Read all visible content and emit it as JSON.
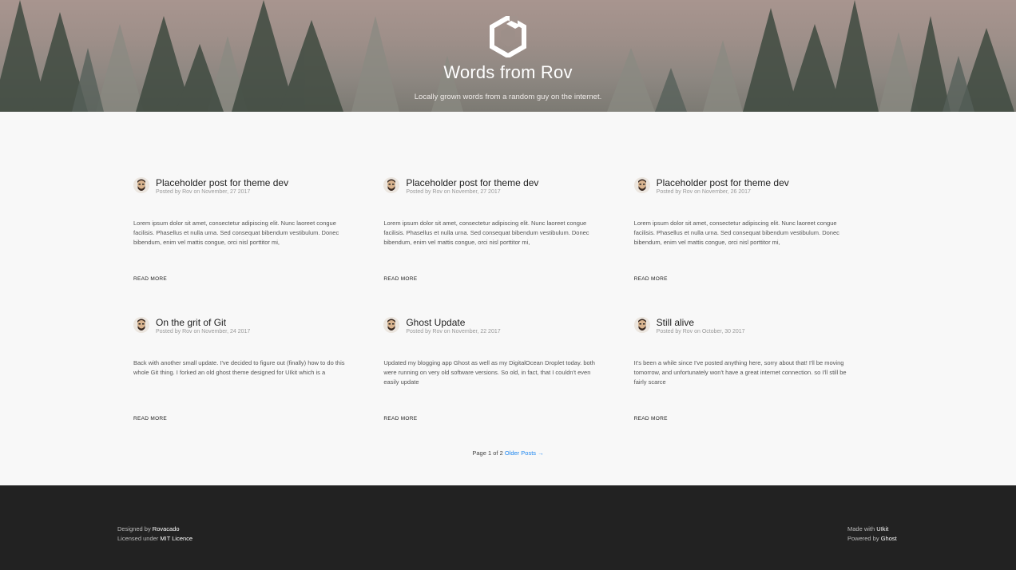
{
  "header": {
    "site_title": "Words from Rov",
    "site_description": "Locally grown words from a random guy on the internet.",
    "logo_icon": "uikit-logo-icon"
  },
  "posts": [
    {
      "title": "Placeholder post for theme dev",
      "meta": "Posted by Rov on November, 27 2017",
      "excerpt": "Lorem ipsum dolor sit amet, consectetur adipiscing elit. Nunc laoreet congue facilisis. Phasellus et nulla urna. Sed consequat bibendum vestibulum. Donec bibendum, enim vel mattis congue, orci nisl porttitor mi,",
      "read_more": "READ MORE"
    },
    {
      "title": "Placeholder post for theme dev",
      "meta": "Posted by Rov on November, 27 2017",
      "excerpt": "Lorem ipsum dolor sit amet, consectetur adipiscing elit. Nunc laoreet congue facilisis. Phasellus et nulla urna. Sed consequat bibendum vestibulum. Donec bibendum, enim vel mattis congue, orci nisl porttitor mi,",
      "read_more": "READ MORE"
    },
    {
      "title": "Placeholder post for theme dev",
      "meta": "Posted by Rov on November, 26 2017",
      "excerpt": "Lorem ipsum dolor sit amet, consectetur adipiscing elit. Nunc laoreet congue facilisis. Phasellus et nulla urna. Sed consequat bibendum vestibulum. Donec bibendum, enim vel mattis congue, orci nisl porttitor mi,",
      "read_more": "READ MORE"
    },
    {
      "title": "On the grit of Git",
      "meta": "Posted by Rov on November, 24 2017",
      "excerpt": "Back with another small update. I've decided to figure out (finally) how to do this whole Git thing. I forked an old ghost theme designed for UIkit which is a",
      "read_more": "READ MORE"
    },
    {
      "title": "Ghost Update",
      "meta": "Posted by Rov on November, 22 2017",
      "excerpt": "Updated my blogging app Ghost as well as my DigitalOcean Droplet today. both were running on very old software versions. So old, in fact, that I couldn't even easily update",
      "read_more": "READ MORE"
    },
    {
      "title": "Still alive",
      "meta": "Posted by Rov on October, 30 2017",
      "excerpt": "It's been a while since I've posted anything here, sorry about that! I'll be moving tomorrow, and unfortunately won't have a great internet connection. so I'll still be fairly scarce",
      "read_more": "READ MORE"
    }
  ],
  "pagination": {
    "text": "Page 1 of 2",
    "older_link": "Older Posts →"
  },
  "footer": {
    "designed_by_prefix": "Designed by ",
    "designed_by_name": "Rovacado",
    "licensed_prefix": "Licensed under ",
    "licence_name": "MIT Licence",
    "made_with_prefix": "Made with ",
    "made_with_name": "UIkit",
    "powered_prefix": "Powered by ",
    "powered_name": "Ghost"
  },
  "colors": {
    "link": "#1e87f0",
    "footer_bg": "#222222",
    "page_bg": "#f8f8f8"
  }
}
